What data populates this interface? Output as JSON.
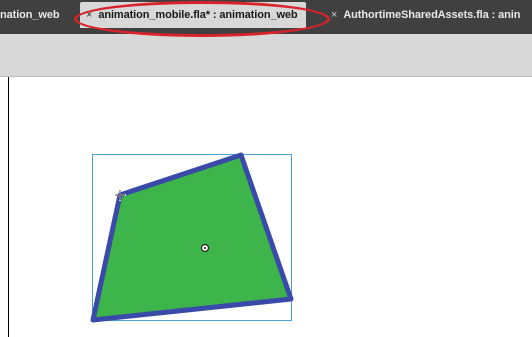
{
  "tabs": [
    {
      "label": "nation_web",
      "active": false
    },
    {
      "close_glyph": "×",
      "label": "animation_mobile.fla* : animation_web",
      "active": true
    },
    {
      "close_glyph": "×",
      "label": "AuthortimeSharedAssets.fla : anin",
      "active": false
    }
  ],
  "colors": {
    "tabbar": "#404040",
    "active_tab": "#d8d8d8",
    "annotation": "#d9232b",
    "shape_fill": "#3db54a",
    "shape_stroke": "#3a4aa8",
    "selection_box": "#4aa3d8"
  },
  "icons": {
    "anchor_point": "crosshair-icon",
    "transform_point": "registration-point-icon"
  }
}
